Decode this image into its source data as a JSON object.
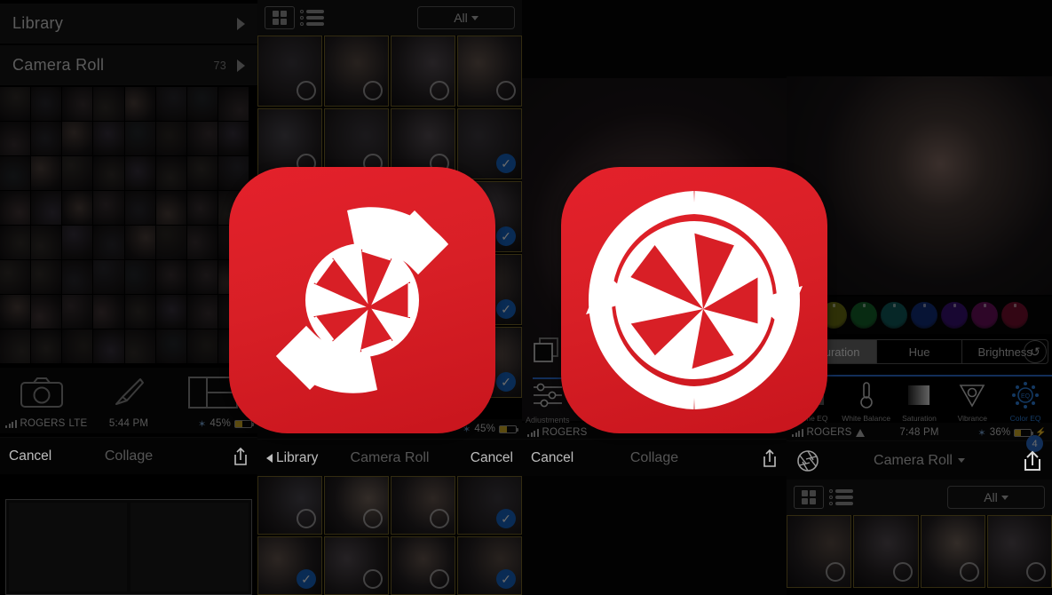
{
  "app": {
    "accent_red": "#d81f26",
    "icon_white": "#ffffff",
    "select_blue": "#1666c8"
  },
  "panels": {
    "library": {
      "rows": [
        {
          "label": "Library",
          "count": "",
          "chevron": "chevron-right-icon"
        },
        {
          "label": "Camera Roll",
          "count": "73",
          "chevron": "chevron-right-icon"
        }
      ],
      "status_bar": {
        "carrier": "ROGERS",
        "network": "LTE",
        "time": "5:44 PM",
        "battery": "45%",
        "bluetooth": "bluetooth-icon"
      },
      "toolbar": [
        {
          "name": "camera-icon",
          "label": ""
        },
        {
          "name": "brush-icon",
          "label": ""
        },
        {
          "name": "collage-layout-icon",
          "label": ""
        }
      ],
      "navbar": {
        "left": "Cancel",
        "title": "Collage",
        "right": "share-icon"
      }
    },
    "picker": {
      "topbar": {
        "grid_view_icon": "grid-view-icon",
        "list_view_icon": "list-view-icon",
        "filter_label": "All",
        "filter_caret": "caret-down-icon"
      },
      "navbar": {
        "back": "Library",
        "title": "Camera Roll",
        "right": "Cancel"
      },
      "status_bar": {
        "battery": "45%",
        "bluetooth": "bluetooth-icon"
      }
    },
    "editor": {
      "side_tools": [
        {
          "name": "layers-icon",
          "label": ""
        },
        {
          "name": "adjustments-sliders-icon",
          "label": "Adjustments"
        }
      ],
      "status_bar": {
        "carrier": "ROGERS",
        "signal": "signal-icon"
      },
      "navbar": {
        "left": "Cancel",
        "title": "Collage",
        "right": "share-icon"
      }
    },
    "adjustments": {
      "segmented": [
        {
          "label": "Saturation",
          "active": true
        },
        {
          "label": "Hue",
          "active": false
        },
        {
          "label": "Brightness",
          "active": false
        }
      ],
      "reset_icon": "reset-rotate-icon",
      "tool_tabs": [
        {
          "label": "Tone EQ",
          "icon": "tone-eq-icon",
          "active": false
        },
        {
          "label": "White Balance",
          "icon": "thermometer-icon",
          "active": false
        },
        {
          "label": "Saturation",
          "icon": "saturation-gradient-icon",
          "active": false
        },
        {
          "label": "Vibrance",
          "icon": "vibrance-triangle-icon",
          "active": false
        },
        {
          "label": "Color EQ",
          "icon": "color-eq-icon",
          "active": true
        }
      ],
      "color_wheels": [
        "#6b5a14",
        "#6f7412",
        "#14662b",
        "#0f5e5e",
        "#12307f",
        "#3b1177",
        "#6e1060",
        "#7a1030"
      ],
      "status_bar": {
        "carrier": "ROGERS",
        "network": "wifi-icon",
        "time": "7:48 PM",
        "battery": "36%",
        "bluetooth": "bluetooth-icon",
        "charging": "charging-bolt-icon"
      },
      "navbar": {
        "left_icon": "aperture-icon",
        "title": "Camera Roll",
        "title_caret": "caret-down-icon",
        "right_icon": "upload-icon",
        "right_badge": "4"
      },
      "bottom_bar": {
        "grid_view_icon": "grid-view-icon",
        "list_view_icon": "list-view-icon",
        "filter_label": "All",
        "filter_caret": "caret-down-icon"
      }
    }
  },
  "app_icons": [
    {
      "name": "snapshot-app-icon",
      "glyph": "swoosh-aperture",
      "background": "#d81f26",
      "foreground": "#ffffff"
    },
    {
      "name": "reload-app-icon",
      "glyph": "refresh-aperture",
      "background": "#d81f26",
      "foreground": "#ffffff"
    }
  ]
}
